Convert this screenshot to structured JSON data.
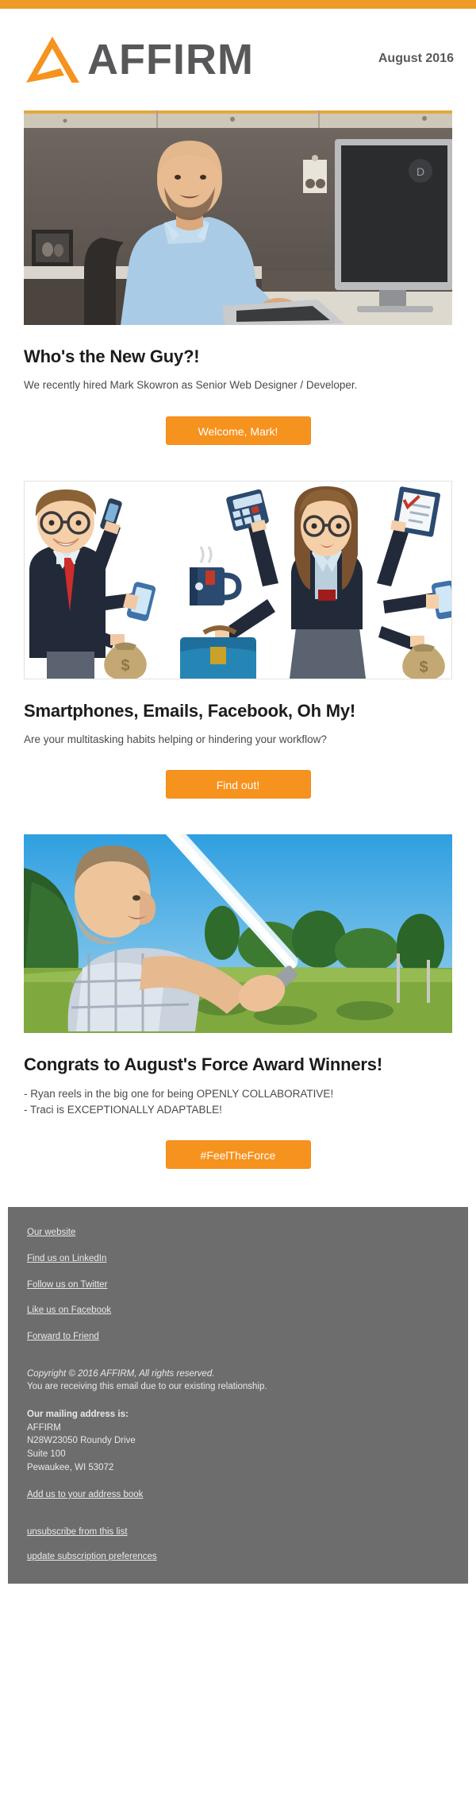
{
  "brand": {
    "name": "AFFIRM",
    "accent_color": "#f6921e",
    "logo_text_color": "#58585a",
    "footer_bg": "#6d6d6d"
  },
  "header": {
    "logo_word": "AFFIRM",
    "date": "August 2016"
  },
  "sections": [
    {
      "image_alt": "Smiling bald man with beard in light blue shirt sitting at office cubicle desk with Dell monitor and laptop",
      "title": "Who's the New Guy?!",
      "body": "We recently hired Mark Skowron as Senior Web Designer / Developer.",
      "cta": "Welcome, Mark!"
    },
    {
      "image_alt": "Flat illustration of a businessman and businesswoman with multiple arms holding smartphones, calculator, clipboard, coffee mug, briefcase and money bags",
      "title": "Smartphones, Emails, Facebook, Oh My!",
      "body": "Are your multitasking habits helping or hindering your workflow?",
      "cta": "Find out!"
    },
    {
      "image_alt": "Man in plaid shirt swinging a white lightsaber outdoors against a blue sky with green trees",
      "title": "Congrats to August's Force Award Winners!",
      "body_lines": [
        "- Ryan reels in the big one for being OPENLY COLLABORATIVE!",
        "- Traci is EXCEPTIONALLY ADAPTABLE!"
      ],
      "cta": "#FeelTheForce"
    }
  ],
  "footer": {
    "social_links": [
      "Our website",
      "Find us on LinkedIn",
      "Follow us on Twitter",
      "Like us on Facebook",
      "Forward to Friend"
    ],
    "copyright": "Copyright © 2016 AFFIRM, All rights reserved.",
    "receiving_notice": "You are receiving this email due to our existing relationship.",
    "address_title": "Our mailing address is:",
    "address_lines": [
      "AFFIRM",
      "N28W23050 Roundy Drive",
      "Suite 100",
      "Pewaukee, WI 53072"
    ],
    "address_book_link": "Add us to your address book",
    "bottom_links": [
      "unsubscribe from this list",
      "update subscription preferences"
    ]
  }
}
